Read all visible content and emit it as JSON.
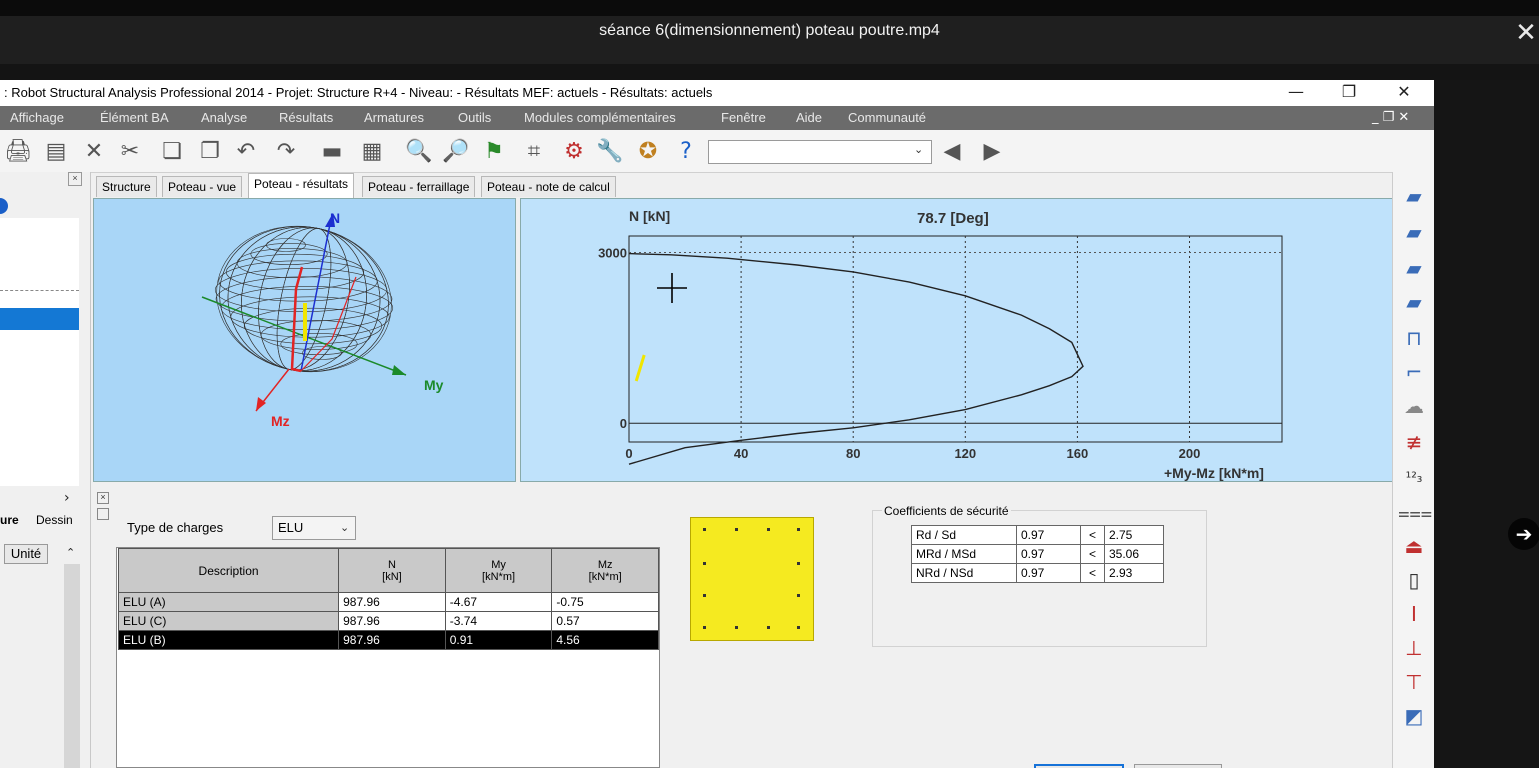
{
  "player": {
    "video_title": "séance 6(dimensionnement) poteau poutre.mp4",
    "close_glyph": "✕",
    "next_glyph": "➔"
  },
  "app": {
    "window_title": ": Robot Structural Analysis Professional 2014 - Projet: Structure R+4 - Niveau:  - Résultats MEF: actuels - Résultats: actuels",
    "win_minimize": "—",
    "win_restore": "❐",
    "win_close": "✕",
    "menu": [
      "Affichage",
      "Élément BA",
      "Analyse",
      "Résultats",
      "Armatures",
      "Outils",
      "Modules complémentaires",
      "Fenêtre",
      "Aide",
      "Communauté"
    ],
    "menu_controls": "_ ❐ ✕",
    "toolbar_combo_value": ""
  },
  "left_panel": {
    "tab_active": "ure",
    "tab_other": "Dessin",
    "column_header": "Unité",
    "close": "×",
    "scroll_right": "›"
  },
  "tabs": [
    "Structure",
    "Poteau - vue",
    "Poteau - résultats",
    "Poteau - ferraillage",
    "Poteau - note de calcul"
  ],
  "view3d": {
    "axis_n": "N",
    "axis_my": "My",
    "axis_mz": "Mz",
    "colors": {
      "n": "#1c2fd0",
      "my": "#1b8a2a",
      "mz": "#e22424",
      "force": "#f0e600"
    }
  },
  "chart_data": {
    "type": "line",
    "title": "78.7 [Deg]",
    "ylabel": "N [kN]",
    "xlabel": "+My-Mz [kN*m]",
    "xlim": [
      0,
      233
    ],
    "ylim": [
      -330,
      3290
    ],
    "x_ticks": [
      0,
      40,
      80,
      120,
      160,
      200
    ],
    "y_ticks": [
      0,
      3000
    ],
    "grid": true,
    "series": [
      {
        "x": [
          0,
          15,
          35,
          60,
          80,
          100,
          120,
          140,
          150,
          158,
          162,
          158,
          150,
          140,
          120,
          100,
          80,
          60,
          40,
          20,
          0
        ],
        "y": [
          2980,
          2960,
          2900,
          2780,
          2660,
          2480,
          2240,
          1900,
          1660,
          1420,
          1000,
          820,
          660,
          500,
          240,
          60,
          -80,
          -180,
          -300,
          -430,
          -720
        ]
      }
    ],
    "reference_line_y": 3000,
    "load_point": {
      "x": 4,
      "y": 988
    }
  },
  "form": {
    "type_label": "Type de charges",
    "type_value": "ELU",
    "table": {
      "headers": [
        "Description",
        "N\n[kN]",
        "My\n[kN*m]",
        "Mz\n[kN*m]"
      ],
      "rows": [
        {
          "desc": "ELU (A)",
          "n": "987.96",
          "my": "-4.67",
          "mz": "-0.75",
          "selected": false
        },
        {
          "desc": "ELU (C)",
          "n": "987.96",
          "my": "-3.74",
          "mz": "0.57",
          "selected": false
        },
        {
          "desc": "ELU (B)",
          "n": "987.96",
          "my": "0.91",
          "mz": "4.56",
          "selected": true
        }
      ]
    }
  },
  "coefficients": {
    "title": "Coefficients de sécurité",
    "rows": [
      {
        "label": "Rd / Sd",
        "value": "0.97",
        "op": "<",
        "limit": "2.75"
      },
      {
        "label": "MRd / MSd",
        "value": "0.97",
        "op": "<",
        "limit": "35.06"
      },
      {
        "label": "NRd / NSd",
        "value": "0.97",
        "op": "<",
        "limit": "2.93"
      }
    ]
  },
  "section_color": "#f5ea20"
}
